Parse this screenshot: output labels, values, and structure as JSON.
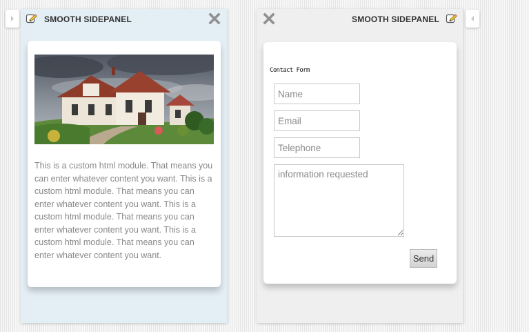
{
  "left_panel": {
    "title": "SMOOTH SIDEPANEL",
    "module_text": "This is a custom html module. That means you can enter whatever content you want. This is a custom html module. That means you can enter whatever content you want. This is a custom html module. That means you can enter whatever content you want. This is a custom html module. That means you can enter whatever content you want."
  },
  "right_panel": {
    "title": "SMOOTH SIDEPANEL",
    "form": {
      "title": "Contact Form",
      "name_placeholder": "Name",
      "email_placeholder": "Email",
      "telephone_placeholder": "Telephone",
      "message_placeholder": "information requested",
      "send_label": "Send"
    }
  },
  "icons": {
    "pencil": "pencil-icon",
    "close": "close-icon",
    "open_left": "chevron-right-icon",
    "open_right": "chevron-left-icon"
  },
  "colors": {
    "left_panel_background": "#e3eef5",
    "right_panel_background": "#efefef",
    "card_background": "#ffffff",
    "module_text": "#888888"
  }
}
